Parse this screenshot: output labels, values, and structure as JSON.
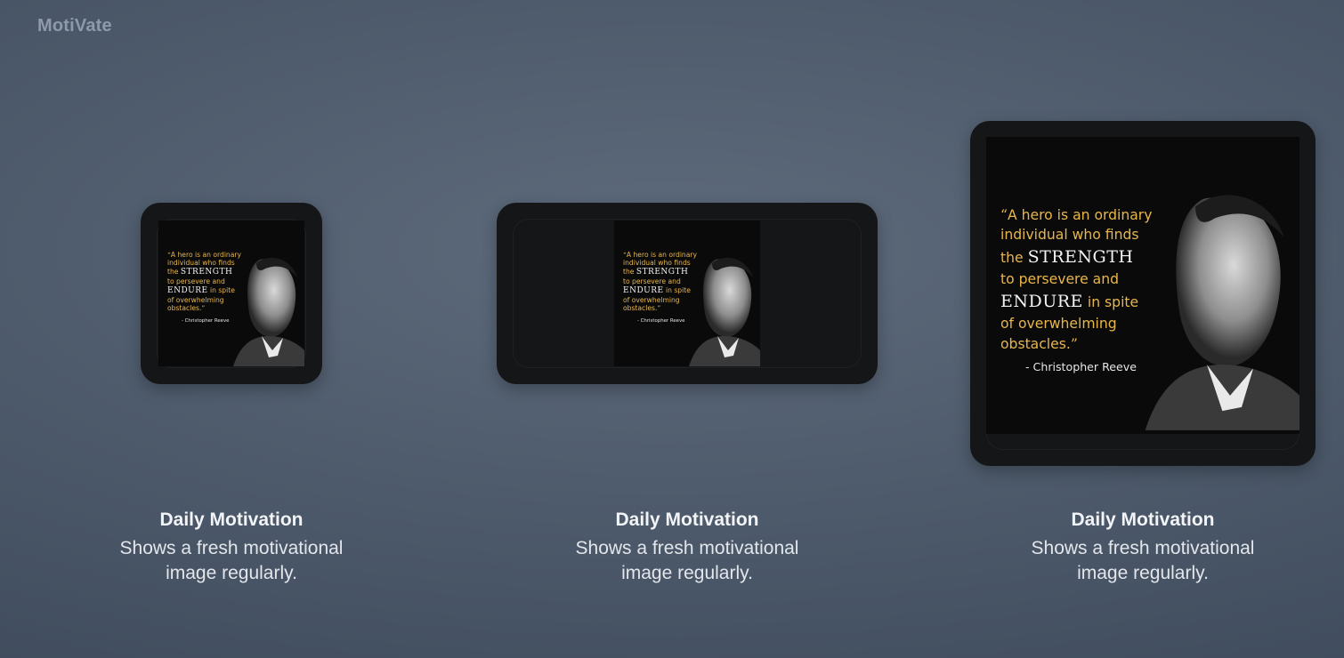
{
  "app": {
    "title": "MotiVate"
  },
  "widget": {
    "title": "Daily Motivation",
    "description_line1": "Shows a fresh motivational",
    "description_line2": "image regularly."
  },
  "quote": {
    "open_mark": "“",
    "line1": "A hero is an ordinary",
    "line2": "individual who finds",
    "line3_pre": "the ",
    "line3_highlight": "STRENGTH",
    "line4": "to persevere and",
    "line5_highlight": "ENDURE",
    "line5_post": " in spite",
    "line6": "of overwhelming",
    "line7": "obstacles.",
    "close_mark": "”",
    "attribution": "- Christopher Reeve"
  },
  "colors": {
    "quote_gold": "#e8b64a",
    "widget_bg": "#151618",
    "poster_bg": "#0a0a0b"
  },
  "widget_sizes": [
    "small",
    "medium",
    "large"
  ]
}
